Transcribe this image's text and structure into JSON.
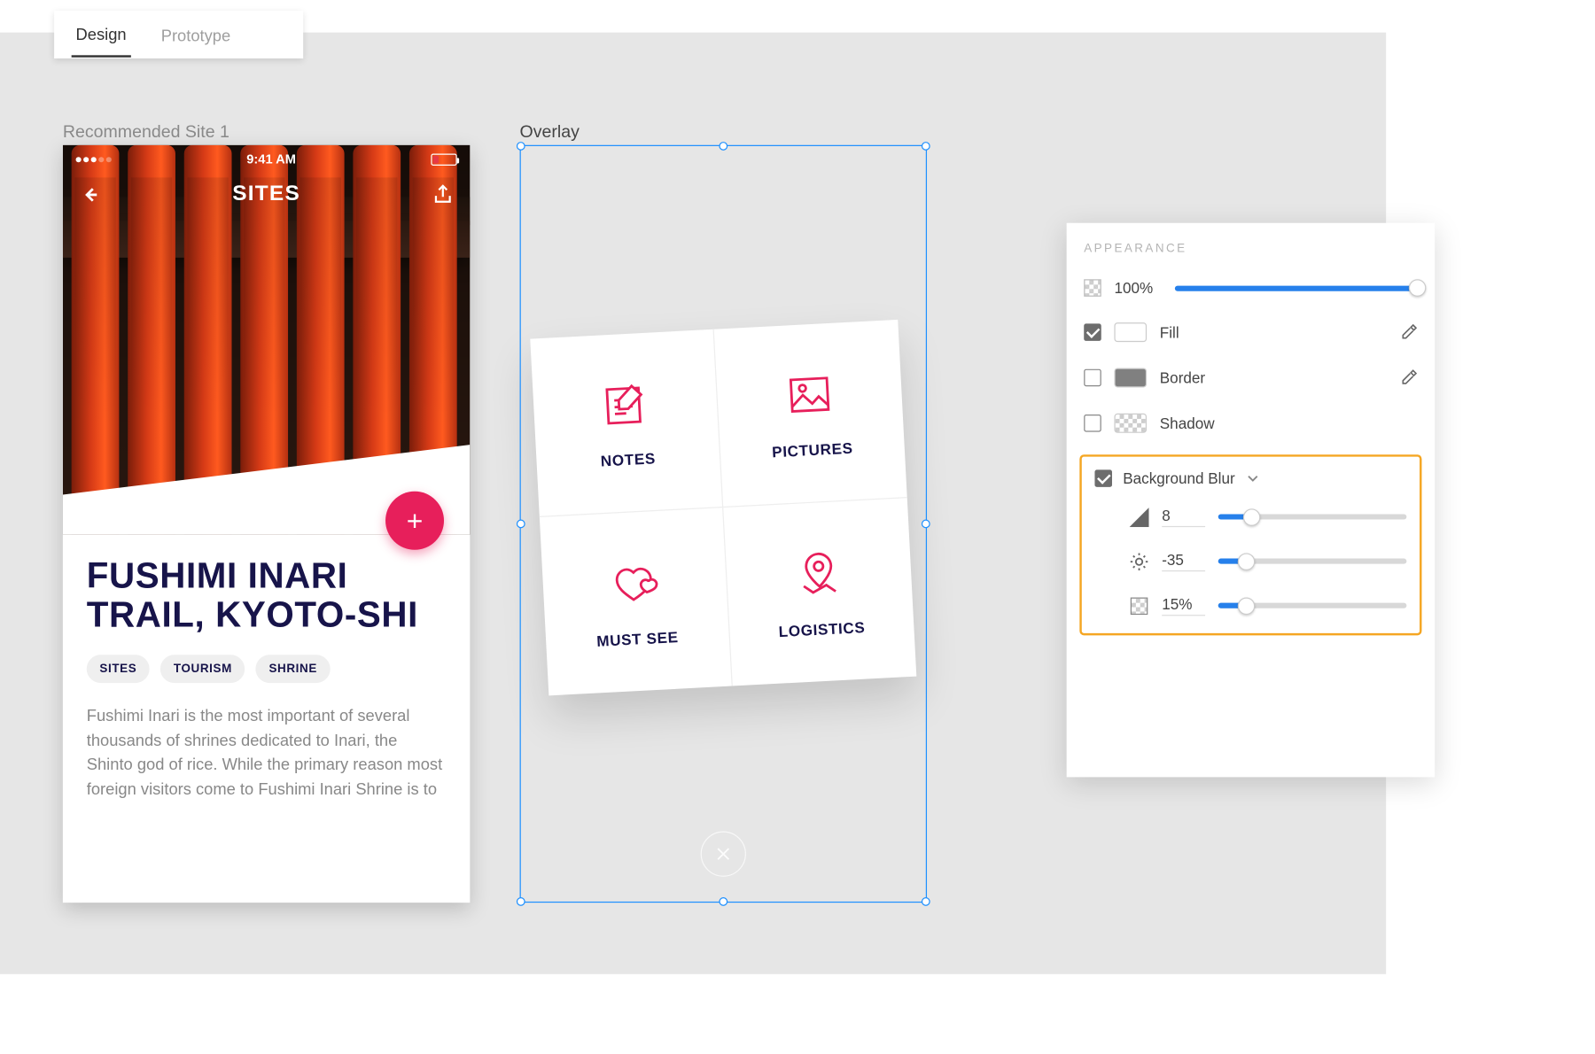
{
  "tabs": {
    "design": "Design",
    "prototype": "Prototype"
  },
  "artboard1": {
    "label": "Recommended Site 1",
    "statusTime": "9:41 AM",
    "topbarTitle": "SITES",
    "title": "FUSHIMI INARI TRAIL, KYOTO-SHI",
    "chips": [
      "SITES",
      "TOURISM",
      "SHRINE"
    ],
    "desc": "Fushimi Inari is the most important of several thousands of shrines dedicated to Inari, the Shinto god of rice. While the primary reason most foreign visitors come to Fushimi Inari Shrine is to"
  },
  "artboard2": {
    "label": "Overlay",
    "cells": [
      "NOTES",
      "PICTURES",
      "MUST SEE",
      "LOGISTICS"
    ]
  },
  "panel": {
    "title": "APPEARANCE",
    "opacity": "100%",
    "fill": "Fill",
    "border": "Border",
    "shadow": "Shadow",
    "bgblur": "Background Blur",
    "amount": "8",
    "brightness": "-35",
    "bgOpacity": "15%"
  }
}
